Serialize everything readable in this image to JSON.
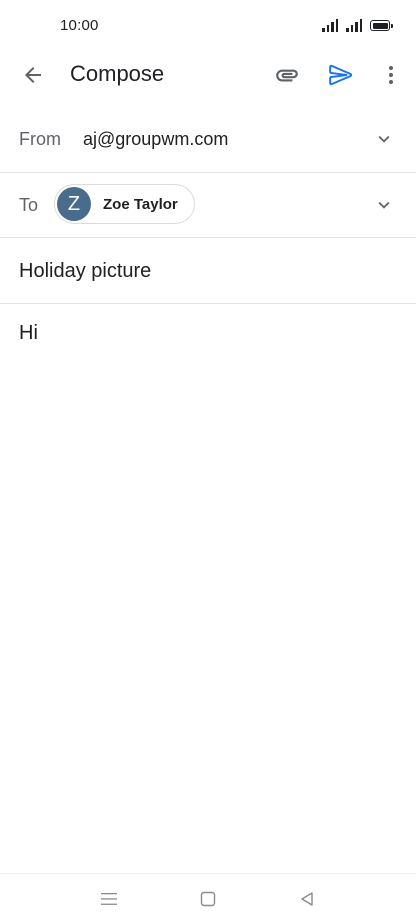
{
  "status_bar": {
    "time": "10:00"
  },
  "app_bar": {
    "title": "Compose",
    "icons": {
      "back": "arrow-back-icon",
      "attach": "paperclip-icon",
      "send": "send-icon",
      "more": "more-vert-icon"
    },
    "send_color": "#1a73e8"
  },
  "compose": {
    "from_label": "From",
    "from_value": "aj@groupwm.com",
    "to_label": "To",
    "recipient": {
      "initial": "Z",
      "name": "Zoe Taylor",
      "avatar_color": "#4a6c8c"
    },
    "subject": "Holiday picture",
    "body": "Hi"
  },
  "nav_bar": {
    "icons": [
      "menu-icon",
      "home-square-icon",
      "back-triangle-icon"
    ]
  }
}
